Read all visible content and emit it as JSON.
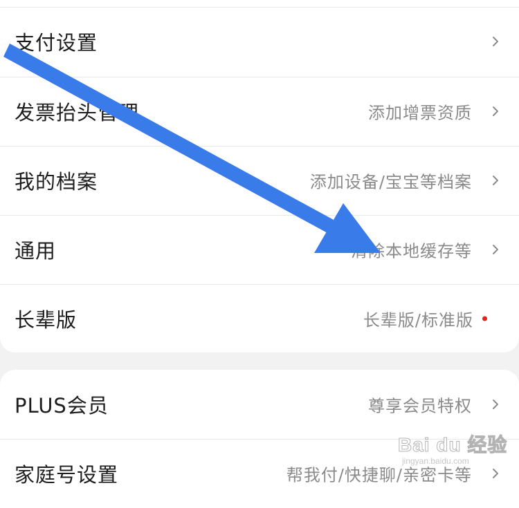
{
  "settings": {
    "group1": [
      {
        "label": "支付设置",
        "value": ""
      },
      {
        "label": "发票抬头管理",
        "value": "添加增票资质"
      },
      {
        "label": "我的档案",
        "value": "添加设备/宝宝等档案"
      },
      {
        "label": "通用",
        "value": "清除本地缓存等"
      },
      {
        "label": "长辈版",
        "value": "长辈版/标准版",
        "badge": "red-dot"
      }
    ],
    "group2": [
      {
        "label": "PLUS会员",
        "value": "尊享会员特权"
      },
      {
        "label": "家庭号设置",
        "value": "帮我付/快捷聊/亲密卡等"
      }
    ]
  },
  "overlay": {
    "annotation": "blue-arrow",
    "color": "#3a7bea"
  },
  "watermark": {
    "logo": "Bai du 经验",
    "sub": "jingyan.baidu.com"
  },
  "icons": {
    "chevron": "chevron-right-icon",
    "chevron_color": "#8a8a8a",
    "badge_color": "#e2231a"
  }
}
